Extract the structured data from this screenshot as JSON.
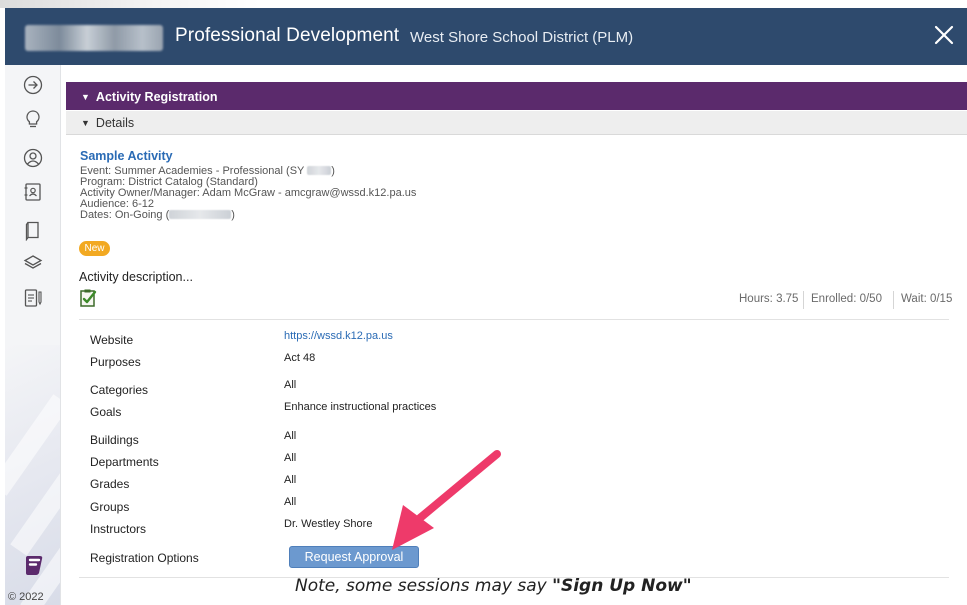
{
  "header": {
    "app_title": "Professional Development",
    "district": "West Shore School District (PLM)"
  },
  "footer": {
    "copyright": "© 2022"
  },
  "sections": {
    "activity_registration": "Activity Registration",
    "details": "Details"
  },
  "activity": {
    "title": "Sample Activity",
    "event_prefix": "Event: Summer Academies - Professional (SY ",
    "event_suffix": ")",
    "program": "Program: District Catalog (Standard)",
    "owner": "Activity Owner/Manager: Adam McGraw  - amcgraw@wssd.k12.pa.us",
    "audience": "Audience: 6-12",
    "dates_prefix": "Dates: On-Going (",
    "dates_suffix": ")",
    "badge": "New",
    "description": "Activity description..."
  },
  "stats": {
    "hours": "Hours: 3.75",
    "enrolled": "Enrolled: 0/50",
    "wait": "Wait: 0/15"
  },
  "fields": [
    {
      "label": "Website",
      "value": "https://wssd.k12.pa.us"
    },
    {
      "label": "Purposes",
      "value": "Act 48"
    },
    {
      "label": "Categories",
      "value": "All"
    },
    {
      "label": "Goals",
      "value": "Enhance instructional practices"
    },
    {
      "label": "Buildings",
      "value": "All"
    },
    {
      "label": "Departments",
      "value": "All"
    },
    {
      "label": "Grades",
      "value": "All"
    },
    {
      "label": "Groups",
      "value": "All"
    },
    {
      "label": "Instructors",
      "value": "Dr. Westley Shore"
    },
    {
      "label": "Registration Options",
      "value": "Request Approval"
    }
  ],
  "note": {
    "prefix": "Note, some sessions may say ",
    "emphasis": "\"Sign Up Now\""
  },
  "colors": {
    "header_bg": "#2e4a6d",
    "section_bar": "#5b2a6c",
    "badge": "#f2a922",
    "link": "#2a6bb5",
    "button": "#6c99cf",
    "arrow": "#ee3a6a"
  },
  "icons": {
    "rail": [
      "arrow-right-circle-icon",
      "lightbulb-icon",
      "user-circle-icon",
      "contact-book-icon",
      "book-icon",
      "layers-icon",
      "document-edit-icon"
    ],
    "brand": "frontline-logo-icon",
    "approval": "clipboard-check-icon"
  }
}
